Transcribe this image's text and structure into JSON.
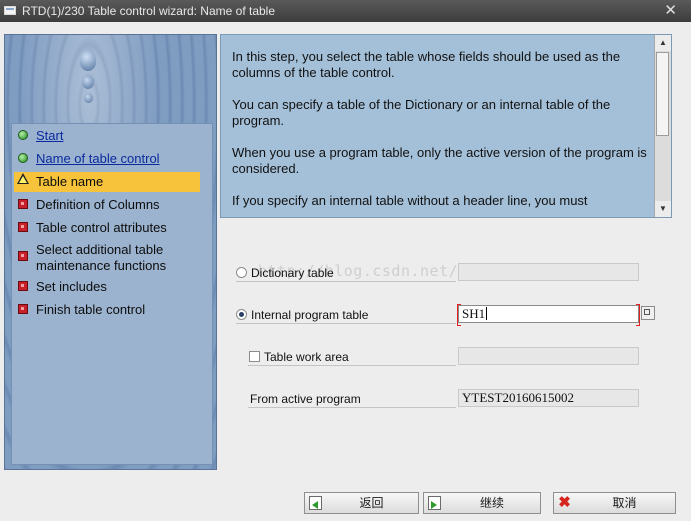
{
  "window": {
    "title": "RTD(1)/230 Table control wizard: Name of table",
    "close_glyph": "✕"
  },
  "steps": [
    {
      "label": "Start",
      "icon": "green-light-icon",
      "state": "done"
    },
    {
      "label": "Name of table control",
      "icon": "green-light-icon",
      "state": "done"
    },
    {
      "label": "Table name",
      "icon": "warning-icon",
      "state": "current"
    },
    {
      "label": "Definition of Columns",
      "icon": "red-square-icon",
      "state": "pending"
    },
    {
      "label": "Table control attributes",
      "icon": "red-square-icon",
      "state": "pending"
    },
    {
      "label": "Select additional table maintenance functions",
      "icon": "red-square-icon",
      "state": "pending"
    },
    {
      "label": "Set includes",
      "icon": "red-square-icon",
      "state": "pending"
    },
    {
      "label": "Finish table control",
      "icon": "red-square-icon",
      "state": "pending"
    }
  ],
  "info": {
    "paragraphs": [
      "In this step, you select the table whose fields should be used as the columns of the table control.",
      "You can specify a table of the Dictionary or an internal table of the program.",
      "When you use a program table, only the active version of the program is considered.",
      "If you specify an internal table without a header line, you must"
    ]
  },
  "form": {
    "dictionary_table": {
      "label": "Dictionary table",
      "value": "",
      "selected": false
    },
    "internal_program_table": {
      "label": "Internal program table",
      "value": "SH1",
      "selected": true
    },
    "table_work_area": {
      "label": "Table work area",
      "value": "",
      "checked": false
    },
    "from_active_program": {
      "label": "From active program",
      "value": "YTEST20160615002"
    }
  },
  "watermark": "http://blog.csdn.net/",
  "buttons": {
    "back": "返回",
    "continue": "继续",
    "cancel": "取消"
  },
  "colors": {
    "current_step_highlight": "#f6c33b",
    "info_background": "#a4c0d8",
    "link": "#0a2a9e"
  }
}
